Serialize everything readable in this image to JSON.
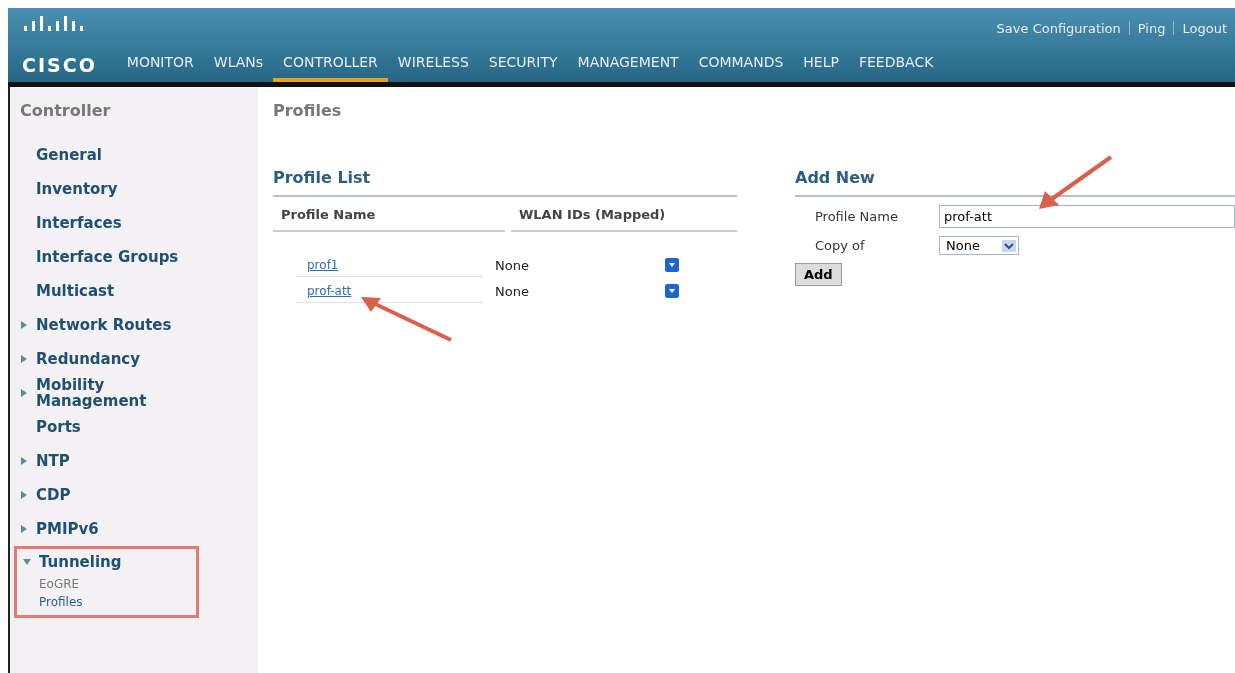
{
  "header": {
    "brand": "CISCO",
    "links": [
      "Save Configuration",
      "Ping",
      "Logout"
    ],
    "tabs": [
      {
        "label": "MONITOR",
        "selected": false
      },
      {
        "label": "WLANs",
        "selected": false
      },
      {
        "label": "CONTROLLER",
        "selected": true
      },
      {
        "label": "WIRELESS",
        "selected": false
      },
      {
        "label": "SECURITY",
        "selected": false
      },
      {
        "label": "MANAGEMENT",
        "selected": false
      },
      {
        "label": "COMMANDS",
        "selected": false
      },
      {
        "label": "HELP",
        "selected": false
      },
      {
        "label": "FEEDBACK",
        "selected": false
      }
    ]
  },
  "sidebar": {
    "title": "Controller",
    "items": [
      {
        "label": "General",
        "kind": "leaf"
      },
      {
        "label": "Inventory",
        "kind": "leaf"
      },
      {
        "label": "Interfaces",
        "kind": "leaf"
      },
      {
        "label": "Interface Groups",
        "kind": "leaf"
      },
      {
        "label": "Multicast",
        "kind": "leaf"
      },
      {
        "label": "Network Routes",
        "kind": "group",
        "expanded": false
      },
      {
        "label": "Redundancy",
        "kind": "group",
        "expanded": false
      },
      {
        "label": "Mobility Management",
        "kind": "group",
        "expanded": false
      },
      {
        "label": "Ports",
        "kind": "leaf"
      },
      {
        "label": "NTP",
        "kind": "group",
        "expanded": false
      },
      {
        "label": "CDP",
        "kind": "group",
        "expanded": false
      },
      {
        "label": "PMIPv6",
        "kind": "group",
        "expanded": false
      },
      {
        "label": "Tunneling",
        "kind": "group",
        "expanded": true,
        "highlighted": true,
        "children": [
          {
            "label": "EoGRE",
            "selected": false
          },
          {
            "label": "Profiles",
            "selected": true
          }
        ]
      }
    ]
  },
  "page_title": "Profiles",
  "profile_list": {
    "title": "Profile List",
    "columns": [
      "Profile Name",
      "WLAN IDs (Mapped)"
    ],
    "rows": [
      {
        "name": "prof1",
        "wlan_ids": "None",
        "pointed": false
      },
      {
        "name": "prof-att",
        "wlan_ids": "None",
        "pointed": true
      }
    ]
  },
  "add_new": {
    "title": "Add New",
    "profile_name_label": "Profile Name",
    "profile_name_value": "prof-att",
    "profile_name_pointed": true,
    "copy_of_label": "Copy of",
    "copy_of_value": "None",
    "add_button": "Add"
  }
}
